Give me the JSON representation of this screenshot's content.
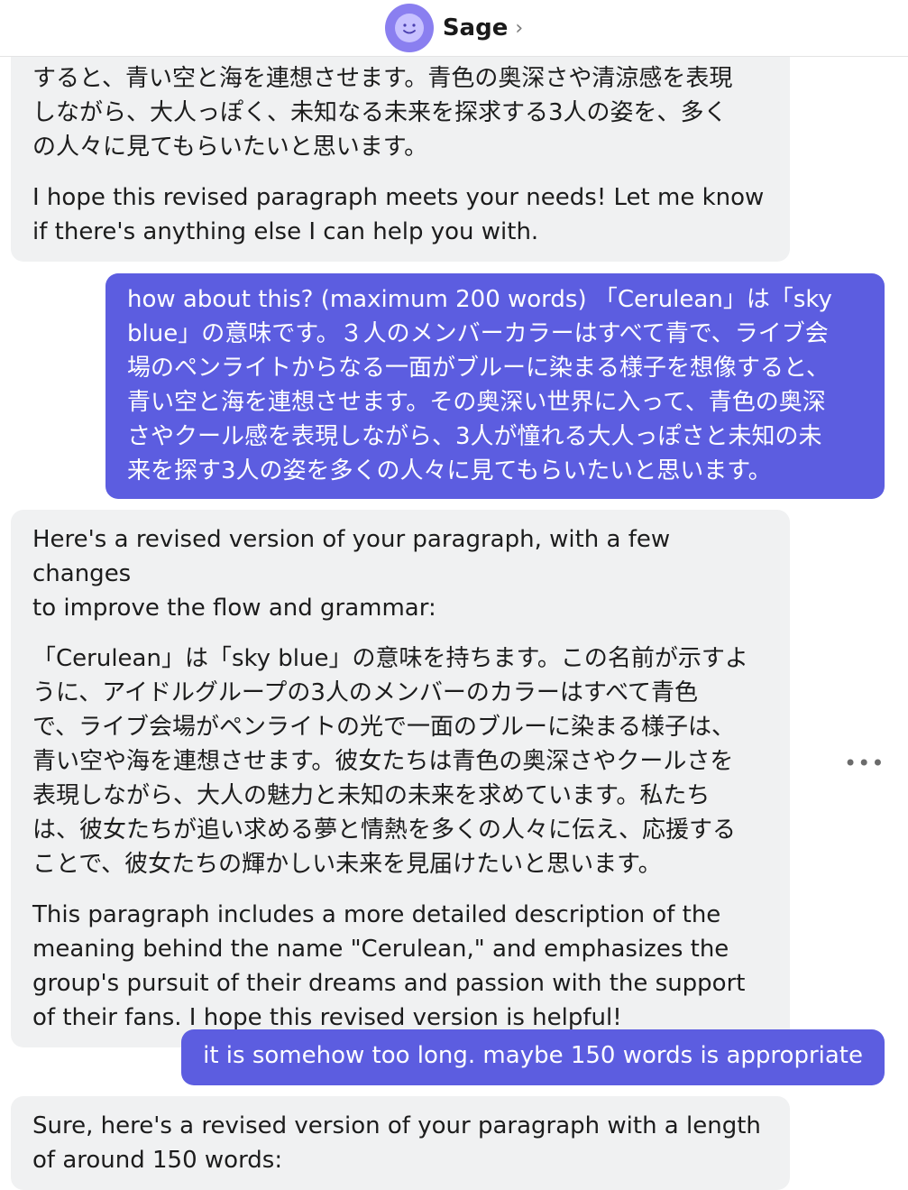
{
  "header": {
    "bot_name": "Sage",
    "chevron": "›",
    "avatar_icon": "smiley-face-icon",
    "accent": "#8a7ff0"
  },
  "messages": [
    {
      "role": "bot",
      "paragraphs": [
        "すると、青い空と海を連想させます。青色の奥深さや清涼感を表現\nしながら、大人っぽく、未知なる未来を探求する3人の姿を、多く\nの人々に見てもらいたいと思います。",
        "I hope this revised paragraph meets your needs! Let me know\nif there's anything else I can help you with."
      ]
    },
    {
      "role": "user",
      "text": "how about this? (maximum 200 words) 「Cerulean」は「sky\nblue」の意味です。３人のメンバーカラーはすべて青で、ライブ会\n場のペンライトからなる一面がブルーに染まる様子を想像すると、\n青い空と海を連想させます。その奥深い世界に入って、青色の奥深\nさやクール感を表現しながら、3人が憧れる大人っぽさと未知の未\n来を探す3人の姿を多くの人々に見てもらいたいと思います。"
    },
    {
      "role": "bot",
      "paragraphs": [
        "Here's a revised version of your paragraph, with a few changes\nto improve the flow and grammar:",
        "「Cerulean」は「sky blue」の意味を持ちます。この名前が示すよ\nうに、アイドルグループの3人のメンバーのカラーはすべて青色\nで、ライブ会場がペンライトの光で一面のブルーに染まる様子は、\n青い空や海を連想させます。彼女たちは青色の奥深さやクールさを\n表現しながら、大人の魅力と未知の未来を求めています。私たち\nは、彼女たちが追い求める夢と情熱を多くの人々に伝え、応援する\nことで、彼女たちの輝かしい未来を見届けたいと思います。",
        "This paragraph includes a more detailed description of the\nmeaning behind the name \"Cerulean,\" and emphasizes the\ngroup's pursuit of their dreams and passion with the support\nof their fans. I hope this revised version is helpful!"
      ]
    },
    {
      "role": "user",
      "text": "it is somehow too long. maybe 150 words is appropriate"
    },
    {
      "role": "bot",
      "paragraphs": [
        "Sure, here's a revised version of your paragraph with a length\nof around 150 words:"
      ]
    }
  ],
  "more_menu": {
    "label": "•••",
    "icon": "more-options-icon"
  }
}
